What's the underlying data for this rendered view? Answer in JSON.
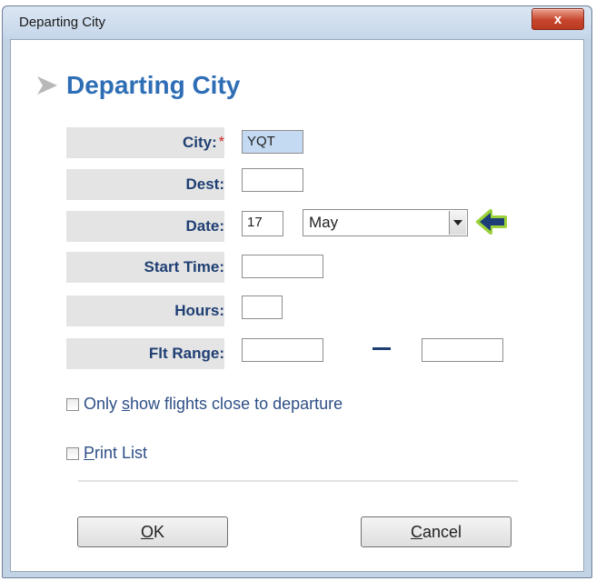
{
  "window": {
    "title": "Departing City",
    "close_label": "x"
  },
  "header": {
    "title": "Departing City"
  },
  "form": {
    "city_label": "City:",
    "city_required": "*",
    "city_value": "YQT",
    "dest_label": "Dest:",
    "dest_value": "",
    "date_label": "Date:",
    "date_day": "17",
    "date_month": "May",
    "start_time_label": "Start Time:",
    "start_time_value": "",
    "hours_label": "Hours:",
    "hours_value": "",
    "flt_range_label": "Flt Range:",
    "flt_range_from": "",
    "flt_range_to": ""
  },
  "options": {
    "close_to_departure": {
      "before": "Only ",
      "accel": "s",
      "after": "how flights close to departure",
      "checked": false
    },
    "print_list": {
      "before": "",
      "accel": "P",
      "after": "rint List",
      "checked": false
    }
  },
  "buttons": {
    "ok": {
      "accel": "O",
      "rest": "K"
    },
    "cancel": {
      "accel": "C",
      "rest": "ancel"
    }
  },
  "colors": {
    "accent": "#2e6eb5",
    "label_text": "#1f3f73",
    "label_bg": "#e4e4e4",
    "filled_input_bg": "#c4daf2",
    "required_mark": "#d12020",
    "indicator_arrow": "#1d3d78",
    "indicator_glow": "#9ad13a"
  }
}
